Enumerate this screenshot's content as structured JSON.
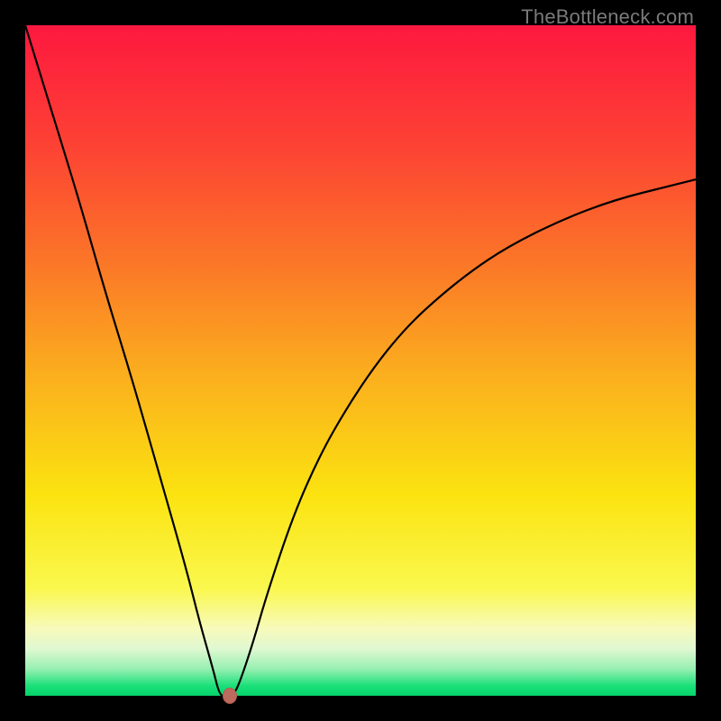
{
  "watermark": "TheBottleneck.com",
  "colors": {
    "bg": "#000000",
    "curve": "#000000",
    "marker": "#bd6a5f",
    "gradient_stops": [
      {
        "pos": 0.0,
        "color": "#fd183f"
      },
      {
        "pos": 0.18,
        "color": "#fd4234"
      },
      {
        "pos": 0.35,
        "color": "#fb7528"
      },
      {
        "pos": 0.52,
        "color": "#fbae1e"
      },
      {
        "pos": 0.7,
        "color": "#fbe310"
      },
      {
        "pos": 0.84,
        "color": "#faf84e"
      },
      {
        "pos": 0.9,
        "color": "#f7fabb"
      },
      {
        "pos": 0.93,
        "color": "#e0f8d1"
      },
      {
        "pos": 0.96,
        "color": "#97f0b1"
      },
      {
        "pos": 0.985,
        "color": "#1be07a"
      },
      {
        "pos": 1.0,
        "color": "#04d46a"
      }
    ]
  },
  "chart_data": {
    "type": "line",
    "title": "",
    "xlabel": "",
    "ylabel": "",
    "xlim": [
      0,
      100
    ],
    "ylim": [
      0,
      100
    ],
    "series": [
      {
        "name": "bottleneck-curve",
        "x": [
          0,
          4,
          8,
          12,
          16,
          20,
          24,
          26,
          28,
          29,
          30,
          31,
          32,
          34,
          36,
          40,
          44,
          48,
          52,
          56,
          60,
          66,
          72,
          80,
          88,
          96,
          100
        ],
        "y": [
          100,
          87,
          74,
          60,
          47,
          33,
          19,
          11,
          4,
          0,
          0,
          0,
          2,
          8,
          15,
          27,
          36,
          43,
          49,
          54,
          58,
          63,
          67,
          71,
          74,
          76,
          77
        ]
      }
    ],
    "marker": {
      "x": 30.5,
      "y": 0
    }
  }
}
